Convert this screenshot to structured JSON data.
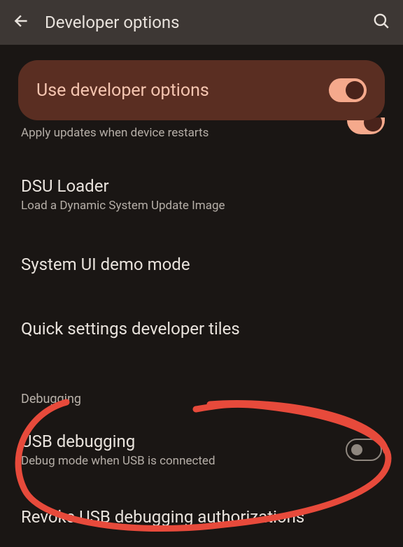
{
  "header": {
    "title": "Developer options"
  },
  "devCard": {
    "label": "Use developer options",
    "enabled": true
  },
  "items": {
    "apply": {
      "sub": "Apply updates when device restarts"
    },
    "dsu": {
      "title": "DSU Loader",
      "sub": "Load a Dynamic System Update Image"
    },
    "demo": {
      "title": "System UI demo mode"
    },
    "quick": {
      "title": "Quick settings developer tiles"
    }
  },
  "section": {
    "debugging": "Debugging"
  },
  "usb": {
    "title": "USB debugging",
    "sub": "Debug mode when USB is connected",
    "enabled": false
  },
  "revoke": {
    "title": "Revoke USB debugging authorizations"
  }
}
